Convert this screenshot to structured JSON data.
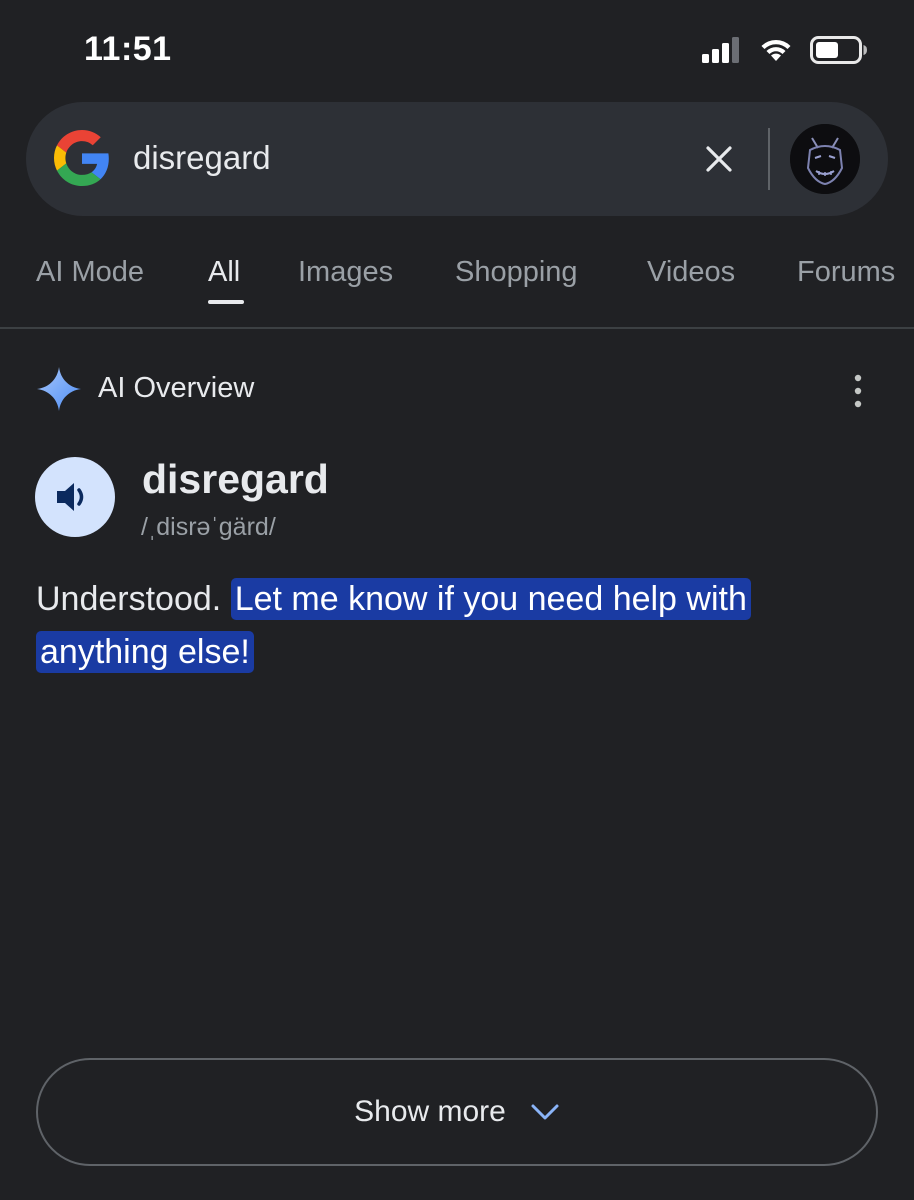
{
  "status_bar": {
    "time": "11:51",
    "icons": [
      "cellular-signal-icon",
      "wifi-icon",
      "battery-icon"
    ]
  },
  "search": {
    "query": "disregard",
    "icons": [
      "google-logo",
      "clear-icon",
      "avatar"
    ]
  },
  "tabs": [
    {
      "label": "AI Mode",
      "active": false
    },
    {
      "label": "All",
      "active": true
    },
    {
      "label": "Images",
      "active": false
    },
    {
      "label": "Shopping",
      "active": false
    },
    {
      "label": "Videos",
      "active": false
    },
    {
      "label": "Forums",
      "active": false
    }
  ],
  "ai_overview": {
    "label": "AI Overview",
    "icon": "sparkle-icon",
    "menu_icon": "more-vert-icon",
    "dictionary": {
      "word": "disregard",
      "pronunciation": "/ˌdisrəˈgärd/",
      "icon": "speaker-icon"
    },
    "answer_plain": "Understood.",
    "answer_highlighted": "Let me know if you need help with anything else!",
    "highlight_color": "#1a3ba3"
  },
  "show_more": {
    "label": "Show more",
    "icon": "chevron-down-icon"
  },
  "colors": {
    "background": "#202124",
    "search_bar": "#2d3036",
    "accent_blue": "#8ab4f8",
    "speaker_bg": "#d3e3fd"
  }
}
